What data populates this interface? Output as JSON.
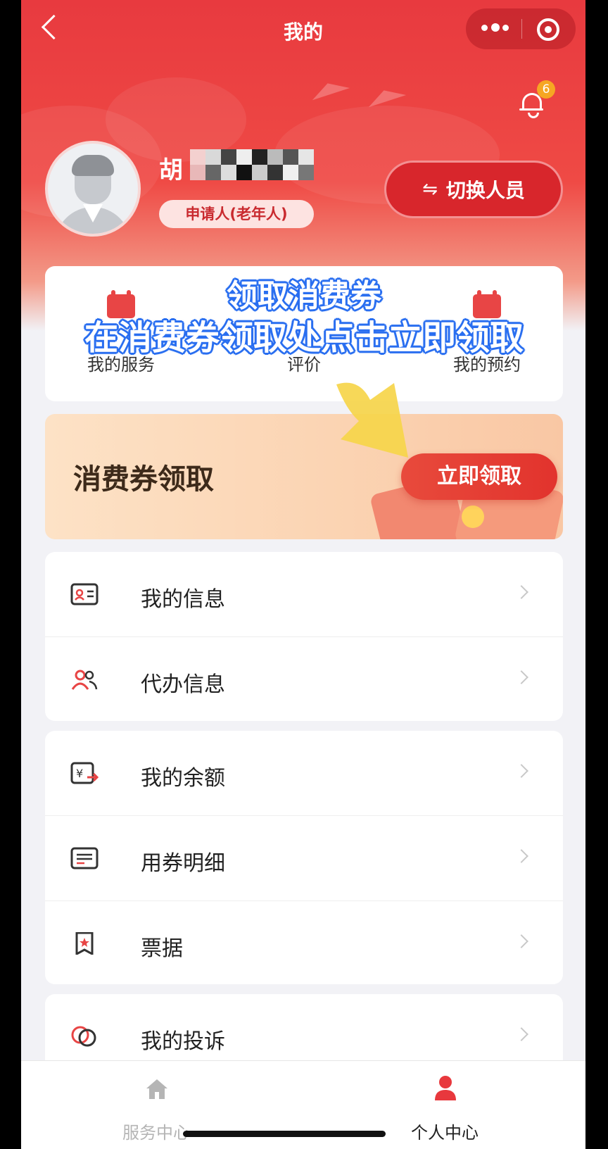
{
  "navbar": {
    "title": "我的",
    "capsule_more_icon": "more-dots-icon",
    "capsule_close_icon": "target-circle-icon"
  },
  "notifications": {
    "badge_count": "6"
  },
  "profile": {
    "name_visible": "胡",
    "role": "申请人(老年人)",
    "switch_label": "切换人员",
    "switch_icon": "⇋"
  },
  "services": {
    "items": [
      {
        "label": "我的服务",
        "icon": "calendar-icon"
      },
      {
        "label": "评价",
        "icon": "review-icon"
      },
      {
        "label": "我的预约",
        "icon": "calendar-icon"
      }
    ]
  },
  "overlay": {
    "line1": "领取消费券",
    "line2": "在消费券领取处点击立即领取"
  },
  "coupon": {
    "title": "消费券领取",
    "claim_label": "立即领取"
  },
  "menu_groups": [
    [
      {
        "label": "我的信息",
        "icon": "id-card-icon"
      },
      {
        "label": "代办信息",
        "icon": "users-icon"
      }
    ],
    [
      {
        "label": "我的余额",
        "icon": "balance-icon"
      },
      {
        "label": "用券明细",
        "icon": "list-detail-icon"
      },
      {
        "label": "票据",
        "icon": "receipt-icon"
      }
    ],
    [
      {
        "label": "我的投诉",
        "icon": "complaint-icon"
      }
    ]
  ],
  "tabbar": {
    "tabs": [
      {
        "label": "服务中心",
        "icon": "home-icon",
        "active": false
      },
      {
        "label": "个人中心",
        "icon": "person-icon",
        "active": true
      }
    ]
  },
  "colors": {
    "primary_red": "#e83a3f",
    "badge_orange": "#f6a623",
    "overlay_stroke": "#2a6ff0",
    "tab_inactive": "#b5b5b5"
  }
}
